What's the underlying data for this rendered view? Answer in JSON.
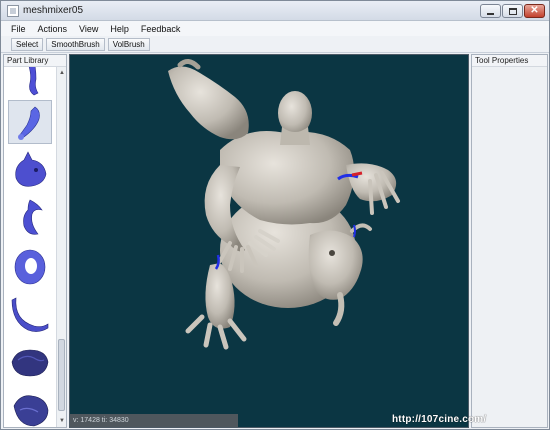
{
  "window": {
    "title": "meshmixer05"
  },
  "menu": [
    "File",
    "Actions",
    "View",
    "Help",
    "Feedback"
  ],
  "toolbar": {
    "buttons": [
      "Select",
      "SmoothBrush",
      "VolBrush"
    ]
  },
  "part_library": {
    "title": "Part Library",
    "items": [
      {
        "name": "leg-part",
        "selected": false
      },
      {
        "name": "arm-part",
        "selected": true
      },
      {
        "name": "animal-head-part",
        "selected": false
      },
      {
        "name": "claw-part",
        "selected": false
      },
      {
        "name": "ring-part",
        "selected": false
      },
      {
        "name": "tail-part",
        "selected": false
      },
      {
        "name": "rock-part",
        "selected": false
      },
      {
        "name": "rock-part-2",
        "selected": false
      }
    ]
  },
  "tool_properties": {
    "title": "Tool Properties"
  },
  "viewport": {
    "status": "v: 17428 ti: 34830",
    "background": "#0b3643"
  },
  "watermark": "http://107cine.com/"
}
